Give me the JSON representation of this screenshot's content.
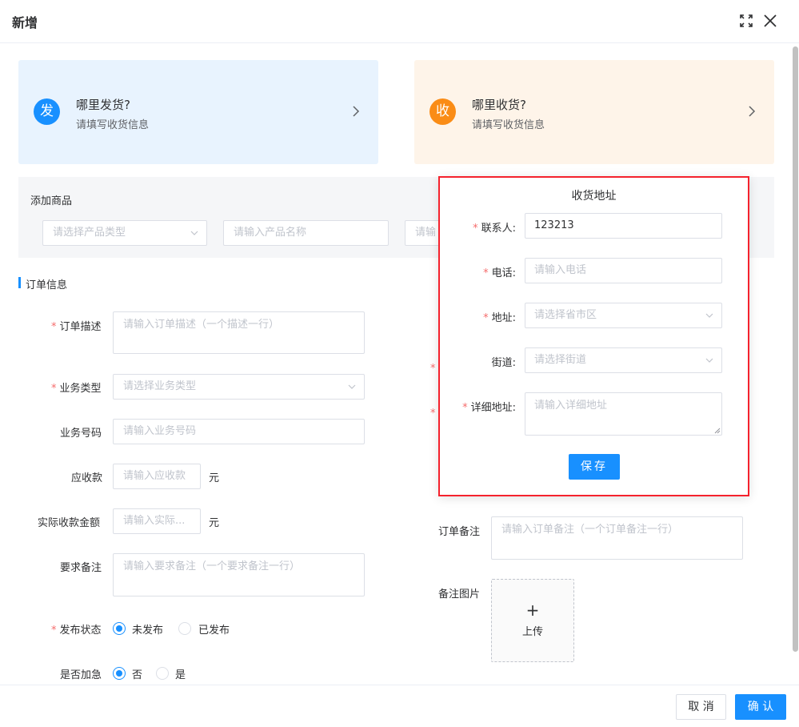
{
  "dialog": {
    "title": "新增",
    "icons": [
      "fullscreen-icon",
      "close-icon"
    ]
  },
  "sender_card": {
    "badge": "发",
    "title": "哪里发货?",
    "subtitle": "请填写收货信息"
  },
  "receiver_card": {
    "badge": "收",
    "title": "哪里收货?",
    "subtitle": "请填写收货信息"
  },
  "products": {
    "label": "添加商品",
    "type_placeholder": "请选择产品类型",
    "name_placeholder": "请输入产品名称",
    "third_placeholder": "请输"
  },
  "order_info": {
    "section_title": "订单信息",
    "fields": {
      "description": {
        "label": "订单描述",
        "required": true,
        "placeholder": "请输入订单描述（一个描述一行）"
      },
      "business_type": {
        "label": "业务类型",
        "required": true,
        "placeholder": "请选择业务类型"
      },
      "business_no": {
        "label": "业务号码",
        "placeholder": "请输入业务号码"
      },
      "receivable": {
        "label": "应收款",
        "placeholder": "请输入应收款",
        "unit": "元"
      },
      "actual_amount": {
        "label": "实际收款金额",
        "placeholder": "请输入实际...",
        "unit": "元"
      },
      "requirement_note": {
        "label": "要求备注",
        "placeholder": "请输入要求备注（一个要求备注一行）"
      },
      "publish_status": {
        "label": "发布状态",
        "required": true,
        "options": [
          "未发布",
          "已发布"
        ],
        "selected": "未发布"
      },
      "urgent": {
        "label": "是否加急",
        "options": [
          "否",
          "是"
        ],
        "selected": "否"
      },
      "order_note": {
        "label": "订单备注",
        "placeholder": "请输入订单备注（一个订单备注一行）"
      },
      "note_image": {
        "label": "备注图片",
        "upload_plus": "+",
        "upload_label": "上传"
      }
    }
  },
  "popover": {
    "title": "收货地址",
    "contact": {
      "label": "联系人:",
      "required": true,
      "value": "123213"
    },
    "phone": {
      "label": "电话:",
      "required": true,
      "placeholder": "请输入电话"
    },
    "region": {
      "label": "地址:",
      "required": true,
      "placeholder": "请选择省市区"
    },
    "street": {
      "label": "街道:",
      "placeholder": "请选择街道"
    },
    "detail": {
      "label": "详细地址:",
      "required": true,
      "placeholder": "请输入详细地址"
    },
    "save_label": "保存"
  },
  "footer": {
    "cancel_label": "取 消",
    "confirm_label": "确 认"
  },
  "colors": {
    "primary": "#1890ff",
    "orange": "#fa8c16",
    "required": "#f56c6c",
    "highlight": "#f5222d"
  }
}
